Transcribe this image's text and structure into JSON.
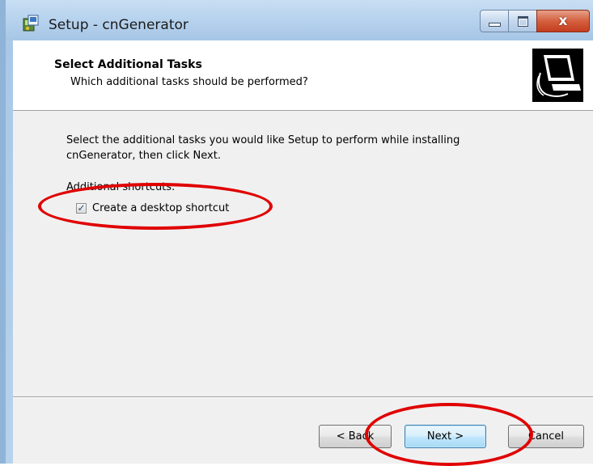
{
  "window": {
    "title": "Setup - cnGenerator",
    "close_glyph": "x",
    "icons": [
      "setup-app-icon",
      "minimize-icon",
      "maximize-icon",
      "close-icon"
    ]
  },
  "header": {
    "title": "Select Additional Tasks",
    "subtitle": "Which additional tasks should be performed?"
  },
  "body": {
    "description_line1": "Select the additional tasks you would like Setup to perform while installing",
    "description_line2": "cnGenerator, then click Next.",
    "group_label": "Additional shortcuts:",
    "checkbox": {
      "label": "Create a desktop shortcut",
      "checked": true,
      "mark": "✓"
    }
  },
  "buttons": {
    "back": "< Back",
    "next": "Next >",
    "cancel": "Cancel"
  },
  "colors": {
    "annotation": "#e00000",
    "titlebar": "#b8d3ee",
    "close_button": "#d5603f"
  }
}
